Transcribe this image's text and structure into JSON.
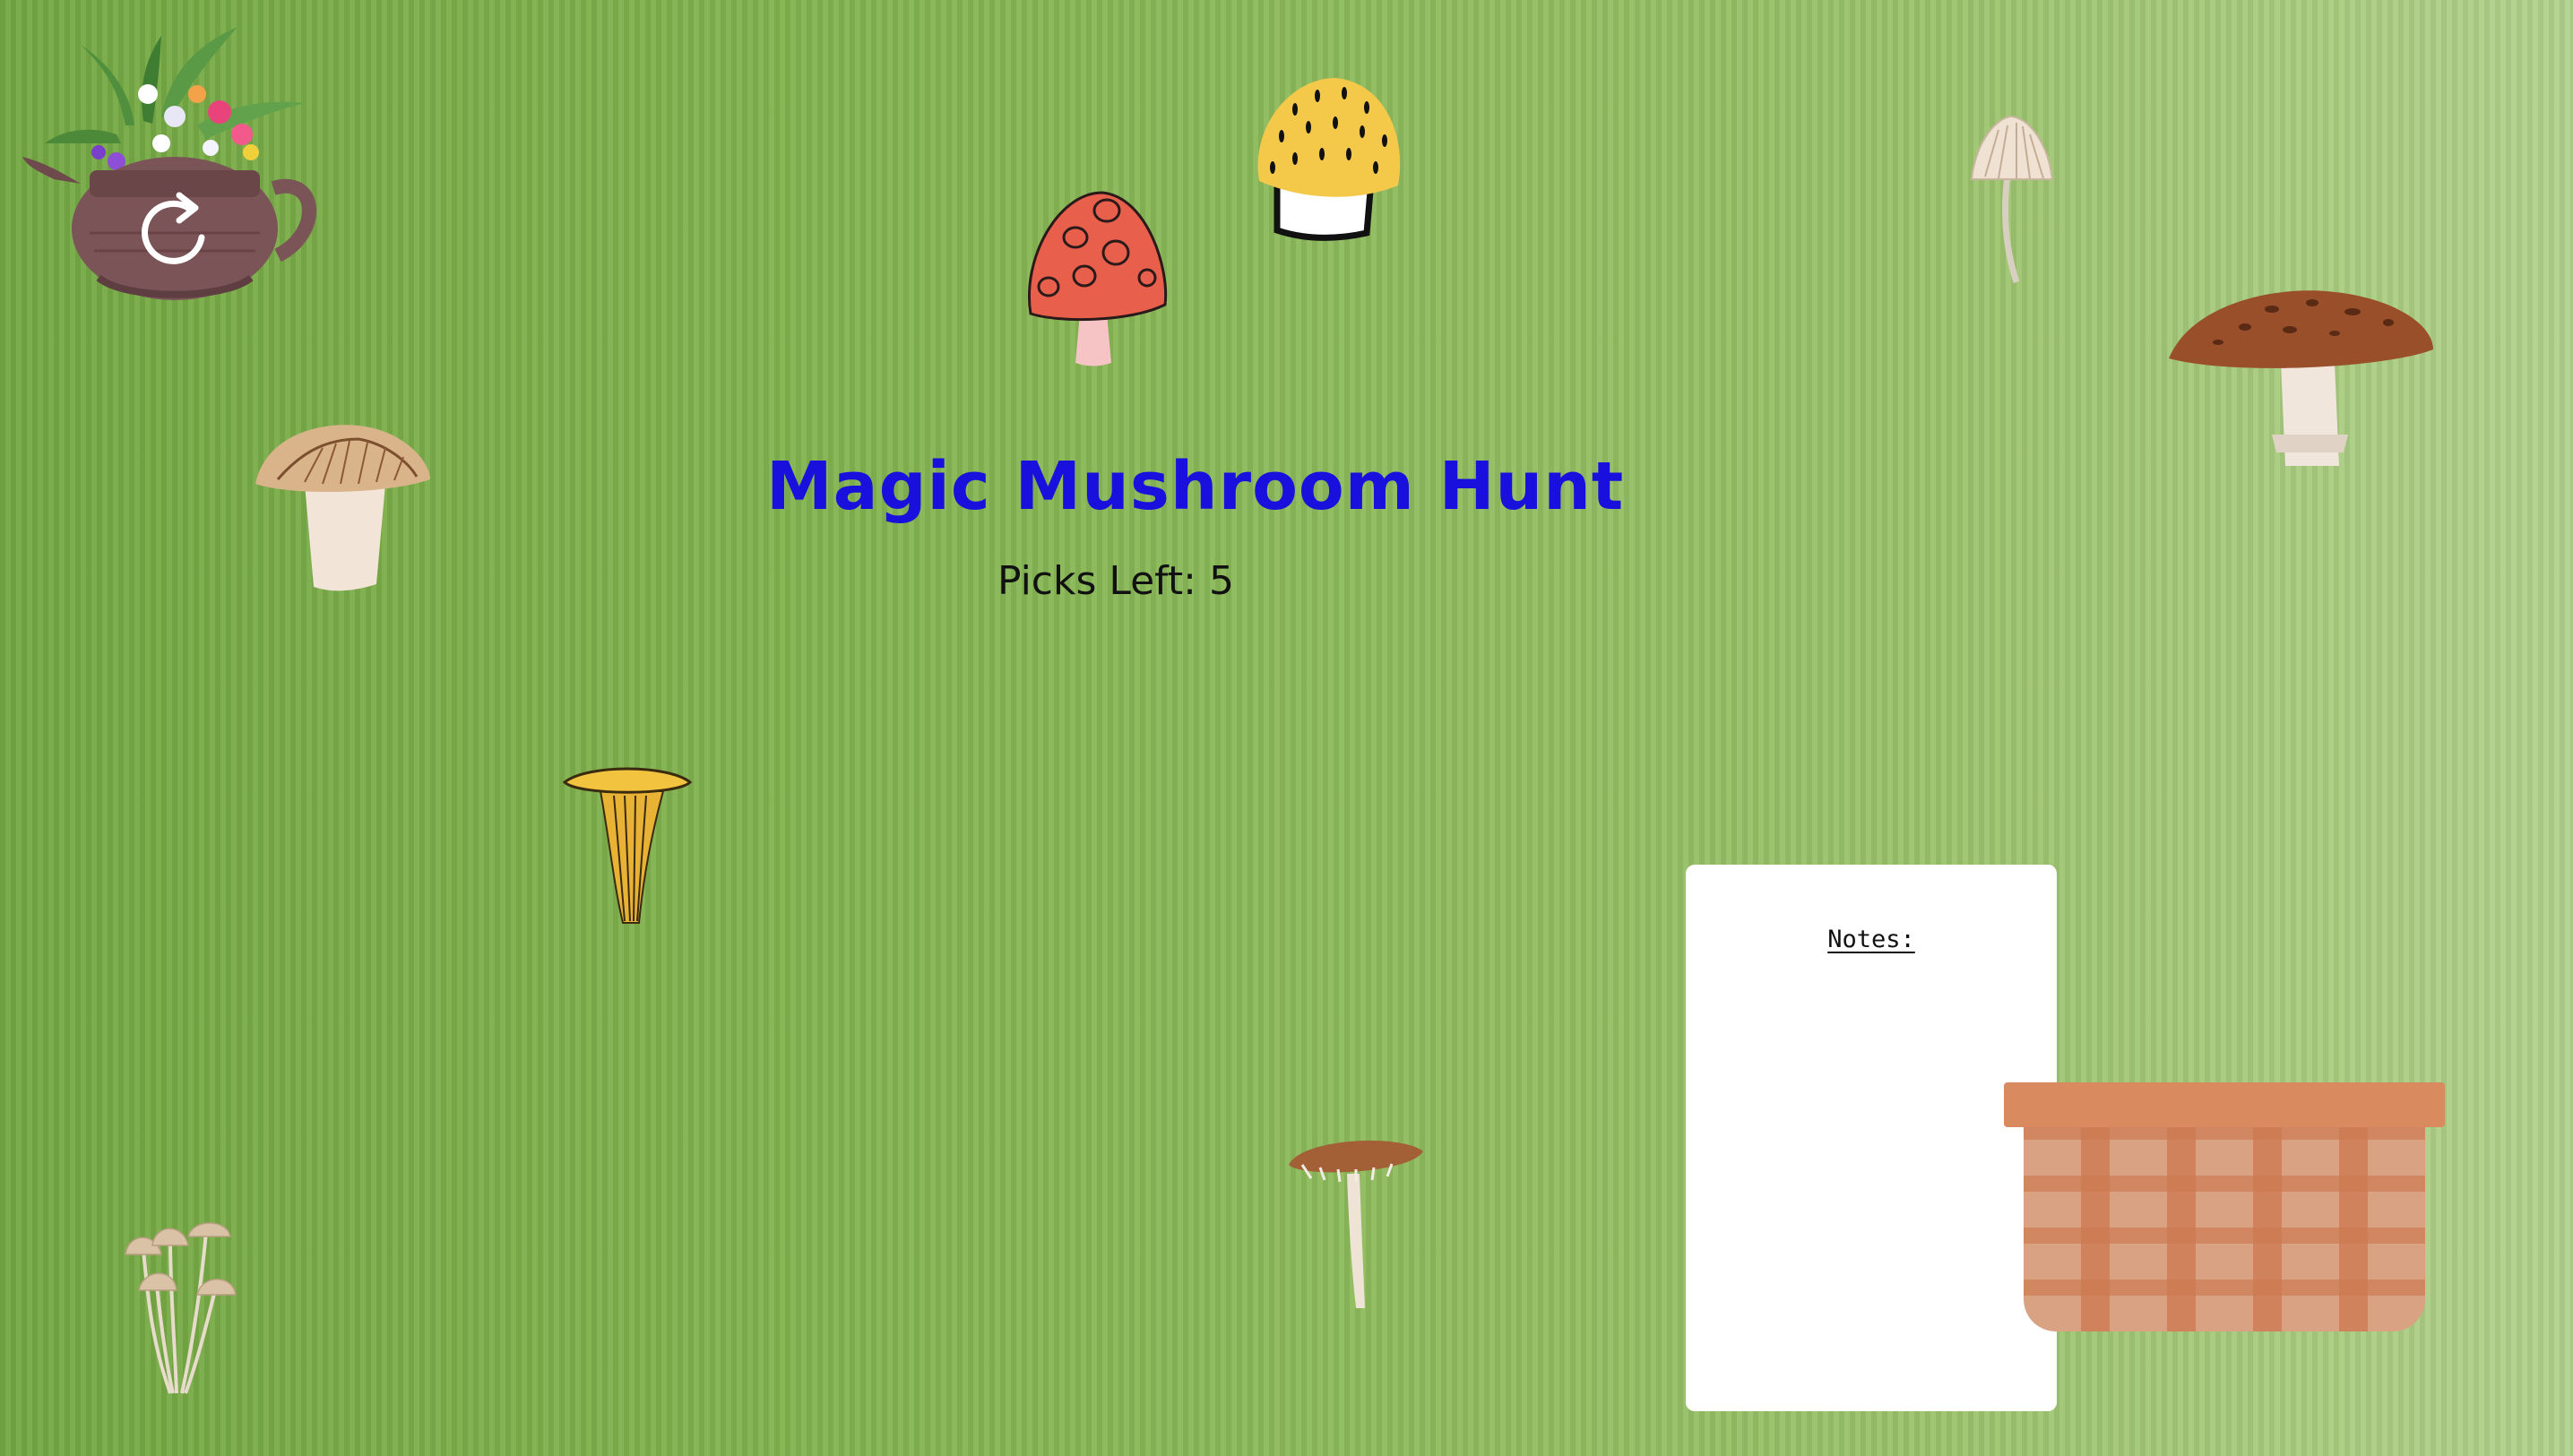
{
  "game": {
    "title": "Magic Mushroom Hunt",
    "picks_label": "Picks Left:",
    "picks_left": "5"
  },
  "notes": {
    "heading": "Notes:"
  },
  "controls": {
    "reset_icon": "refresh-icon"
  },
  "colors": {
    "title": "#1a10dd",
    "background_left": "#74a843",
    "background_right": "#b2d28d",
    "notes_panel": "#ffffff",
    "basket_rim": "#d98a5f",
    "basket_body": "#d9a283"
  },
  "icons": [
    "teapot-flowers-icon",
    "red-spotted-mushroom-icon",
    "yellow-speckled-mushroom-icon",
    "pale-slender-mushroom-icon",
    "brown-spotted-mushroom-icon",
    "tan-cap-mushroom-icon",
    "chanterelle-mushroom-icon",
    "tall-brown-mushroom-icon",
    "mushroom-cluster-icon",
    "basket-icon"
  ]
}
